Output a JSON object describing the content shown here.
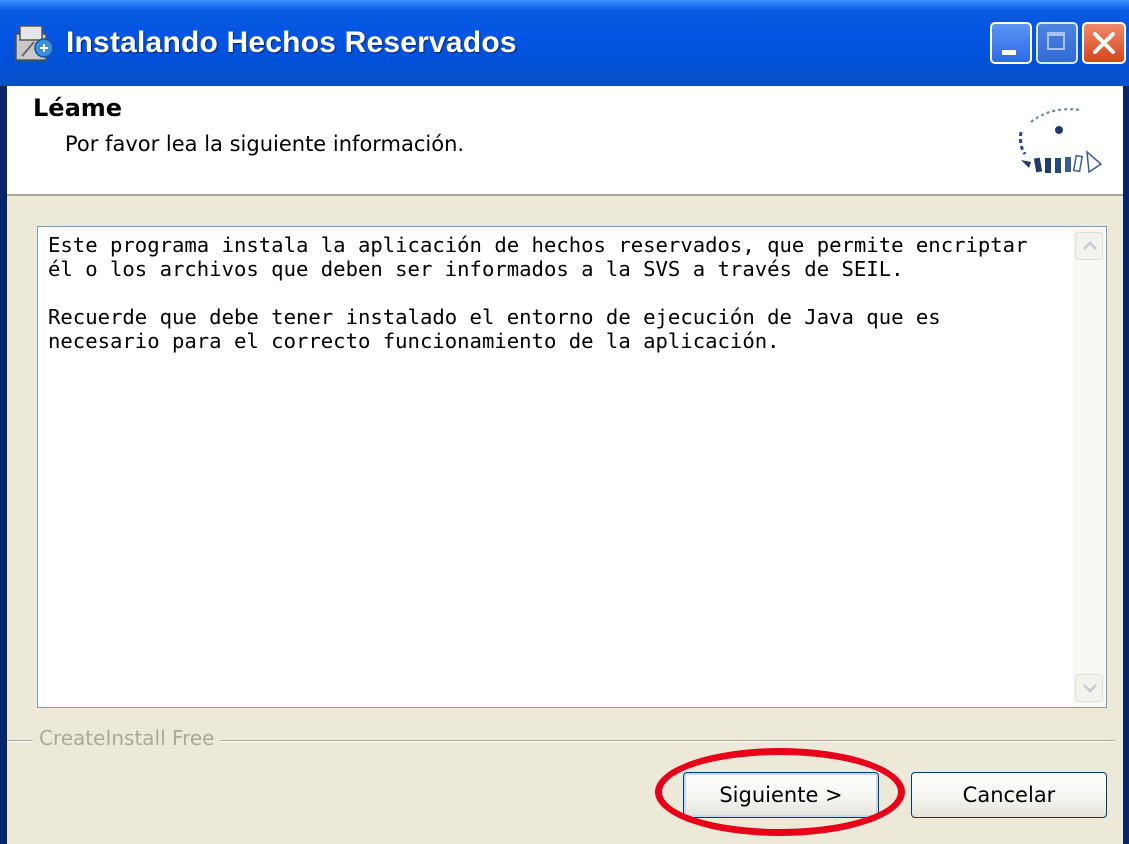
{
  "window": {
    "title": "Instalando Hechos Reservados",
    "icon": "installer-icon"
  },
  "header": {
    "title": "Léame",
    "subtitle": "Por favor lea la siguiente información."
  },
  "readme": {
    "text": "Este programa instala la aplicación de hechos reservados, que permite encriptar\nél o los archivos que deben ser informados a la SVS a través de SEIL.\n\nRecuerde que debe tener instalado el entorno de ejecución de Java que es\nnecesario para el correcto funcionamiento de la aplicación."
  },
  "branding": {
    "text": "CreateInstall Free"
  },
  "buttons": {
    "next_label": "Siguiente >",
    "cancel_label": "Cancelar"
  },
  "colors": {
    "titlebar": "#0355e3",
    "client_bg": "#ece9d8",
    "highlight": "#e8001a"
  }
}
